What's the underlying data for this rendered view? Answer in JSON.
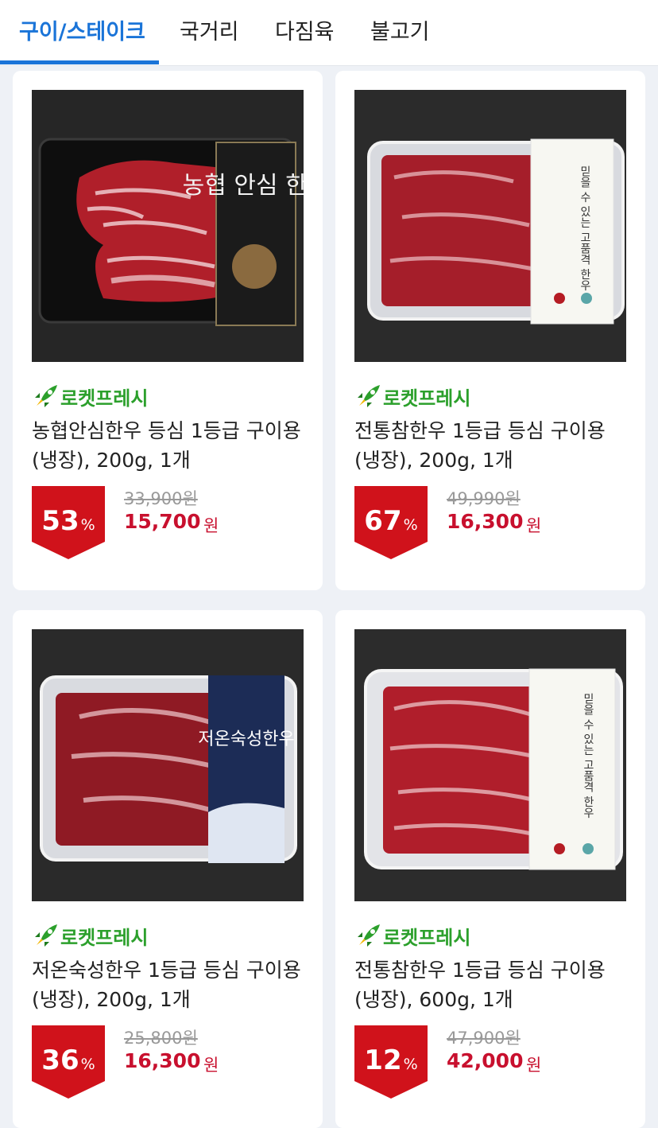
{
  "tabs": [
    {
      "label": "구이/스테이크",
      "active": true
    },
    {
      "label": "국거리"
    },
    {
      "label": "다짐육"
    },
    {
      "label": "불고기"
    }
  ],
  "products": [
    {
      "badge": "로켓프레시",
      "title": "농협안심한우 등심 1등급 구이용 (냉장), 200g, 1개",
      "discount": "53",
      "discount_unit": "%",
      "original_price": "33,900원",
      "price": "15,700",
      "price_unit": "원",
      "image": {
        "tray": "black",
        "label_text": "농협 안심 한우"
      }
    },
    {
      "badge": "로켓프레시",
      "title": "전통참한우 1등급 등심 구이용 (냉장), 200g, 1개",
      "discount": "67",
      "discount_unit": "%",
      "original_price": "49,990원",
      "price": "16,300",
      "price_unit": "원",
      "image": {
        "tray": "clear",
        "label_text": "믿을 수 있는 고품격 한우"
      }
    },
    {
      "badge": "로켓프레시",
      "title": "저온숙성한우 1등급 등심 구이용 (냉장), 200g, 1개",
      "discount": "36",
      "discount_unit": "%",
      "original_price": "25,800원",
      "price": "16,300",
      "price_unit": "원",
      "image": {
        "tray": "clear",
        "label_text": "저온숙성한우"
      }
    },
    {
      "badge": "로켓프레시",
      "title": "전통참한우 1등급 등심 구이용 (냉장), 600g, 1개",
      "discount": "12",
      "discount_unit": "%",
      "original_price": "47,900원",
      "price": "42,000",
      "price_unit": "원",
      "image": {
        "tray": "clear",
        "label_text": "믿을 수 있는 고품격 한우"
      }
    }
  ],
  "colors": {
    "accent": "#1a74d8",
    "badge_green": "#2ca02c",
    "price_red": "#c8102e",
    "discount_bg": "#d0121b"
  }
}
